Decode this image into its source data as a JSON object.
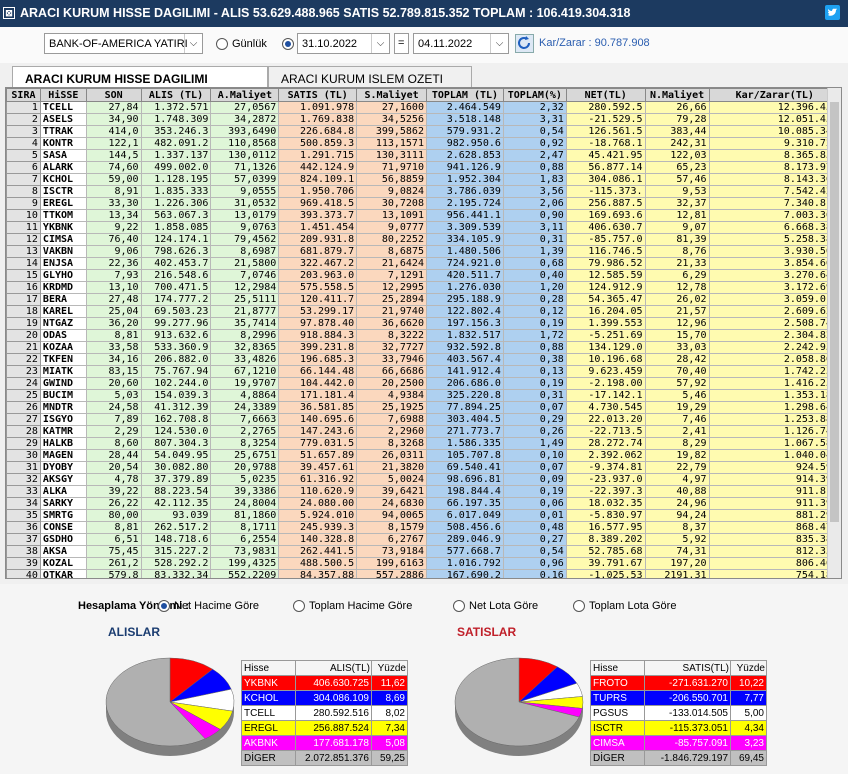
{
  "title": "ARACI KURUM HISSE DAGILIMI - ALIS 53.629.488.965 SATIS 52.789.815.352 TOPLAM : 106.419.304.318",
  "toolbar": {
    "broker": "BANK-OF-AMERICA YATIRIM",
    "option_gunluk": "Günlük",
    "date_from": "31.10.2022",
    "equals": "=",
    "date_to": "04.11.2022",
    "profit_label": "Kar/Zarar : 90.787.908"
  },
  "tabs": [
    "ARACI KURUM HISSE DAGILIMI",
    "ARACI KURUM ISLEM OZETI"
  ],
  "grid": {
    "columns": [
      "SIRA",
      "HiSSE",
      "SON",
      "ALIS (TL)",
      "A.Maliyet",
      "SATIS (TL)",
      "S.Maliyet",
      "TOPLAM (TL)",
      "TOPLAM(%)",
      "NET(TL)",
      "N.Maliyet",
      "Kar/Zarar(TL)"
    ],
    "rows": [
      [
        "1",
        "TCELL",
        "27,84",
        "1.372.571",
        "27,0567",
        "1.091.978",
        "27,1600",
        "2.464.549",
        "2,32",
        "280.592.5",
        "26,66",
        "12.396.453"
      ],
      [
        "2",
        "ASELS",
        "34,90",
        "1.748.309",
        "34,2872",
        "1.769.838",
        "34,5256",
        "3.518.148",
        "3,31",
        "-21.529.5",
        "79,28",
        "12.051.457"
      ],
      [
        "3",
        "TTRAK",
        "414,0",
        "353.246.3",
        "393,6490",
        "226.684.8",
        "399,5862",
        "579.931.2",
        "0,54",
        "126.561.5",
        "383,44",
        "10.085.346"
      ],
      [
        "4",
        "KONTR",
        "122,1",
        "482.091.2",
        "110,8568",
        "500.859.3",
        "113,1571",
        "982.950.6",
        "0,92",
        "-18.768.1",
        "242,31",
        "9.310.723"
      ],
      [
        "5",
        "SASA",
        "144,5",
        "1.337.137",
        "130,0112",
        "1.291.715",
        "130,3111",
        "2.628.853",
        "2,47",
        "45.421.95",
        "122,03",
        "8.365.858"
      ],
      [
        "6",
        "ALARK",
        "74,60",
        "499.002.0",
        "71,1326",
        "442.124.9",
        "71,9710",
        "941.126.9",
        "0,88",
        "56.877.14",
        "65,23",
        "8.173.979"
      ],
      [
        "7",
        "KCHOL",
        "59,00",
        "1.128.195",
        "57,0399",
        "824.109.1",
        "56,8859",
        "1.952.304",
        "1,83",
        "304.086.1",
        "57,46",
        "8.143.366"
      ],
      [
        "8",
        "ISCTR",
        "8,91",
        "1.835.333",
        "9,0555",
        "1.950.706",
        "9,0824",
        "3.786.039",
        "3,56",
        "-115.373.",
        "9,53",
        "7.542.424"
      ],
      [
        "9",
        "EREGL",
        "33,30",
        "1.226.306",
        "31,0532",
        "969.418.5",
        "30,7208",
        "2.195.724",
        "2,06",
        "256.887.5",
        "32,37",
        "7.340.811"
      ],
      [
        "10",
        "TTKOM",
        "13,34",
        "563.067.3",
        "13,0179",
        "393.373.7",
        "13,1091",
        "956.441.1",
        "0,90",
        "169.693.6",
        "12,81",
        "7.003.367"
      ],
      [
        "11",
        "YKBNK",
        "9,22",
        "1.858.085",
        "9,0763",
        "1.451.454",
        "9,0777",
        "3.309.539",
        "3,11",
        "406.630.7",
        "9,07",
        "6.668.381"
      ],
      [
        "12",
        "CIMSA",
        "76,40",
        "124.174.1",
        "79,4562",
        "209.931.8",
        "80,2252",
        "334.105.9",
        "0,31",
        "-85.757.0",
        "81,39",
        "5.258.383"
      ],
      [
        "13",
        "VAKBN",
        "9,06",
        "798.626.3",
        "8,6987",
        "681.879.7",
        "8,6875",
        "1.480.506",
        "1,39",
        "116.746.5",
        "8,76",
        "3.930.508"
      ],
      [
        "14",
        "ENJSA",
        "22,36",
        "402.453.7",
        "21,5800",
        "322.467.2",
        "21,6424",
        "724.921.0",
        "0,68",
        "79.986.52",
        "21,33",
        "3.854.664"
      ],
      [
        "15",
        "GLYHO",
        "7,93",
        "216.548.6",
        "7,0746",
        "203.963.0",
        "7,1291",
        "420.511.7",
        "0,40",
        "12.585.59",
        "6,29",
        "3.270.648"
      ],
      [
        "16",
        "KRDMD",
        "13,10",
        "700.471.5",
        "12,2984",
        "575.558.5",
        "12,2995",
        "1.276.030",
        "1,20",
        "124.912.9",
        "12,78",
        "3.172.698"
      ],
      [
        "17",
        "BERA",
        "27,48",
        "174.777.2",
        "25,5111",
        "120.411.7",
        "25,2894",
        "295.188.9",
        "0,28",
        "54.365.47",
        "26,02",
        "3.059.013"
      ],
      [
        "18",
        "KAREL",
        "25,04",
        "69.503.23",
        "21,8777",
        "53.299.17",
        "21,9740",
        "122.802.4",
        "0,12",
        "16.204.05",
        "21,57",
        "2.609.620"
      ],
      [
        "19",
        "NTGAZ",
        "36,20",
        "99.277.96",
        "35,7414",
        "97.878.40",
        "36,6620",
        "197.156.3",
        "0,19",
        "1.399.553",
        "12,96",
        "2.508.744"
      ],
      [
        "20",
        "ODAS",
        "8,81",
        "913.632.6",
        "8,2996",
        "918.884.3",
        "8,3222",
        "1.832.517",
        "1,72",
        "-5.251.69",
        "15,70",
        "2.304.824"
      ],
      [
        "21",
        "KOZAA",
        "33,58",
        "533.360.9",
        "32,8365",
        "399.231.8",
        "32,7727",
        "932.592.8",
        "0,88",
        "134.129.0",
        "33,03",
        "2.242.930"
      ],
      [
        "22",
        "TKFEN",
        "34,16",
        "206.882.0",
        "33,4826",
        "196.685.3",
        "33,7946",
        "403.567.4",
        "0,38",
        "10.196.68",
        "28,42",
        "2.058.865"
      ],
      [
        "23",
        "MIATK",
        "83,15",
        "75.767.94",
        "67,1210",
        "66.144.48",
        "66,6686",
        "141.912.4",
        "0,13",
        "9.623.459",
        "70,40",
        "1.742.231"
      ],
      [
        "24",
        "GWIND",
        "20,60",
        "102.244.0",
        "19,9707",
        "104.442.0",
        "20,2500",
        "206.686.0",
        "0,19",
        "-2.198.00",
        "57,92",
        "1.416.251"
      ],
      [
        "25",
        "BUCIM",
        "5,03",
        "154.039.3",
        "4,8864",
        "171.181.4",
        "4,9384",
        "325.220.8",
        "0,31",
        "-17.142.1",
        "5,46",
        "1.353.183"
      ],
      [
        "26",
        "MNDTR",
        "24,58",
        "41.312.39",
        "24,3389",
        "36.581.85",
        "25,1925",
        "77.894.25",
        "0,07",
        "4.730.545",
        "19,29",
        "1.298.644"
      ],
      [
        "27",
        "ISGYO",
        "7,89",
        "162.708.8",
        "7,6663",
        "140.695.6",
        "7,6988",
        "303.404.5",
        "0,29",
        "22.013.20",
        "7,46",
        "1.253.880"
      ],
      [
        "28",
        "KATMR",
        "2,29",
        "124.530.0",
        "2,2765",
        "147.243.6",
        "2,2960",
        "271.773.7",
        "0,26",
        "-22.713.5",
        "2,41",
        "1.126.747"
      ],
      [
        "29",
        "HALKB",
        "8,60",
        "807.304.3",
        "8,3254",
        "779.031.5",
        "8,3268",
        "1.586.335",
        "1,49",
        "28.272.74",
        "8,29",
        "1.067.581"
      ],
      [
        "30",
        "MAGEN",
        "28,44",
        "54.049.95",
        "25,6751",
        "51.657.89",
        "26,0311",
        "105.707.8",
        "0,10",
        "2.392.062",
        "19,82",
        "1.040.049"
      ],
      [
        "31",
        "DYOBY",
        "20,54",
        "30.082.80",
        "20,9788",
        "39.457.61",
        "21,3820",
        "69.540.41",
        "0,07",
        "-9.374.81",
        "22,79",
        "924.592"
      ],
      [
        "32",
        "AKSGY",
        "4,78",
        "37.379.89",
        "5,0235",
        "61.316.92",
        "5,0024",
        "98.696.81",
        "0,09",
        "-23.937.0",
        "4,97",
        "914.396"
      ],
      [
        "33",
        "ALKA",
        "39,22",
        "88.223.54",
        "39,3386",
        "110.620.9",
        "39,6421",
        "198.844.4",
        "0,19",
        "-22.397.3",
        "40,88",
        "911.813"
      ],
      [
        "34",
        "SARKY",
        "26,22",
        "42.112.35",
        "24,8004",
        "24.080.00",
        "24,6830",
        "66.197.35",
        "0,06",
        "18.032.35",
        "24,96",
        "911.394"
      ],
      [
        "35",
        "SMRTG",
        "80,00",
        "93.039",
        "81,1860",
        "5.924.010",
        "94,0065",
        "6.017.049",
        "0,01",
        "-5.830.97",
        "94,24",
        "881.291"
      ],
      [
        "36",
        "CONSE",
        "8,81",
        "262.517.2",
        "8,1711",
        "245.939.3",
        "8,1579",
        "508.456.6",
        "0,48",
        "16.577.95",
        "8,37",
        "868.476"
      ],
      [
        "37",
        "GSDHO",
        "6,51",
        "148.718.6",
        "6,2554",
        "140.328.8",
        "6,2767",
        "289.046.9",
        "0,27",
        "8.389.202",
        "5,92",
        "835.384"
      ],
      [
        "38",
        "AKSA",
        "75,45",
        "315.227.2",
        "73,9831",
        "262.441.5",
        "73,9184",
        "577.668.7",
        "0,54",
        "52.785.68",
        "74,31",
        "812.333"
      ],
      [
        "39",
        "KOZAL",
        "261,2",
        "528.292.2",
        "199,4325",
        "488.500.5",
        "199,6163",
        "1.016.792",
        "0,96",
        "39.791.67",
        "197,20",
        "806.462"
      ],
      [
        "40",
        "OTKAR",
        "579,8",
        "83.332.34",
        "552,2209",
        "84.357.88",
        "557,2886",
        "167.690.2",
        "0,16",
        "-1.025.53",
        "2191,31",
        "754.188"
      ]
    ]
  },
  "bottom": {
    "method_label": "Hesaplama Yöntemi :",
    "options": [
      "Net Hacime Göre",
      "Toplam Hacime Göre",
      "Net Lota Göre",
      "Toplam Lota Göre"
    ],
    "buys_title": "ALISLAR",
    "sells_title": "SATISLAR",
    "buys_headers": [
      "Hisse",
      "ALIS(TL)",
      "Yüzde"
    ],
    "sells_headers": [
      "Hisse",
      "SATIS(TL)",
      "Yüzde"
    ],
    "buys": [
      {
        "name": "YKBNK",
        "value": "406.630.725",
        "pct": "11,62",
        "color": "#ff0000",
        "text": "#ffffff"
      },
      {
        "name": "KCHOL",
        "value": "304.086.109",
        "pct": "8,69",
        "color": "#0000ff",
        "text": "#ffffff"
      },
      {
        "name": "TCELL",
        "value": "280.592.516",
        "pct": "8,02",
        "color": "#ffffff",
        "text": "#000000"
      },
      {
        "name": "EREGL",
        "value": "256.887.524",
        "pct": "7,34",
        "color": "#ffff00",
        "text": "#000000"
      },
      {
        "name": "AKBNK",
        "value": "177.681.178",
        "pct": "5,08",
        "color": "#ff00ff",
        "text": "#ffffff"
      },
      {
        "name": "DİGER",
        "value": "2.072.851.376",
        "pct": "59,25",
        "color": "#c0c0c0",
        "text": "#000000"
      }
    ],
    "sells": [
      {
        "name": "FROTO",
        "value": "-271.631.270",
        "pct": "10,22",
        "color": "#ff0000",
        "text": "#ffffff"
      },
      {
        "name": "TUPRS",
        "value": "-206.550.701",
        "pct": "7,77",
        "color": "#0000ff",
        "text": "#ffffff"
      },
      {
        "name": "PGSUS",
        "value": "-133.014.505",
        "pct": "5,00",
        "color": "#ffffff",
        "text": "#000000"
      },
      {
        "name": "ISCTR",
        "value": "-115.373.051",
        "pct": "4,34",
        "color": "#ffff00",
        "text": "#000000"
      },
      {
        "name": "CIMSA",
        "value": "-85.757.091",
        "pct": "3,23",
        "color": "#ff00ff",
        "text": "#ffffff"
      },
      {
        "name": "DİGER",
        "value": "-1.846.729.197",
        "pct": "69,45",
        "color": "#c0c0c0",
        "text": "#000000"
      }
    ]
  }
}
